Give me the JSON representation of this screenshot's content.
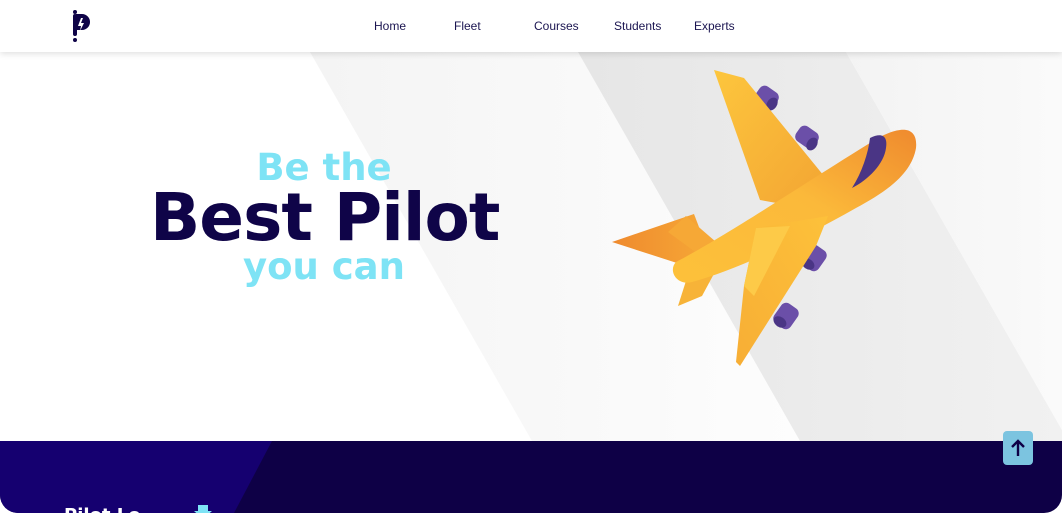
{
  "colors": {
    "brand_navy": "#0f0448",
    "accent_cyan": "#7ee3f5",
    "plane_yellow": "#fdc13a",
    "plane_orange": "#ef8a2e",
    "engine_purple": "#6b4fa8",
    "footer_bg": "#0e0046",
    "scroll_button": "#7cc4e0"
  },
  "header": {
    "logo_icon": "pilot-logo-icon",
    "nav": [
      {
        "label": "Home"
      },
      {
        "label": "Fleet"
      },
      {
        "label": "Courses"
      },
      {
        "label": "Students"
      },
      {
        "label": "Experts"
      }
    ]
  },
  "hero": {
    "tagline_top": "Be the",
    "tagline_main": "Best Pilot",
    "tagline_bottom": "you can",
    "illustration_icon": "airplane-icon"
  },
  "footer": {
    "brand_partial": "Pilot Lo",
    "arrow_icon": "arrow-down-icon"
  },
  "scroll_top": {
    "icon": "arrow-up-icon"
  }
}
